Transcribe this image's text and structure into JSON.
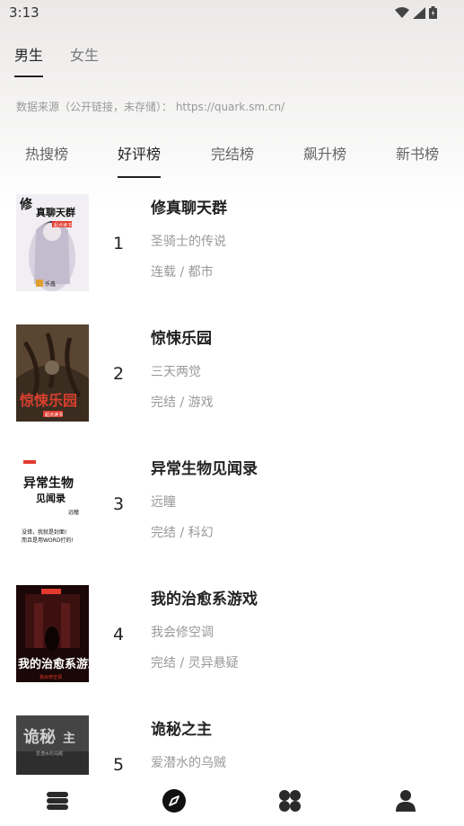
{
  "status": {
    "time": "3:13"
  },
  "gender_tabs": [
    {
      "label": "男生",
      "active": true
    },
    {
      "label": "女生",
      "active": false
    }
  ],
  "source_note": "数据来源（公开链接，未存储）：  https://quark.sm.cn/",
  "rank_tabs": [
    {
      "label": "热搜榜",
      "active": false
    },
    {
      "label": "好评榜",
      "active": true
    },
    {
      "label": "完结榜",
      "active": false
    },
    {
      "label": "飙升榜",
      "active": false
    },
    {
      "label": "新书榜",
      "active": false
    }
  ],
  "books": [
    {
      "rank": "1",
      "title": "修真聊天群",
      "author": "圣骑士的传说",
      "meta": "连载 / 都市",
      "cover_text": "修真聊天群",
      "cover_badge": "起点读书",
      "cover_colors": [
        "#f2f0f2",
        "#c9c4d6"
      ]
    },
    {
      "rank": "2",
      "title": "惊悚乐园",
      "author": "三天两觉",
      "meta": "完结 / 游戏",
      "cover_text": "惊悚乐园",
      "cover_badge": "起点读书",
      "cover_colors": [
        "#4b3a2b",
        "#2a1d14"
      ]
    },
    {
      "rank": "3",
      "title": "异常生物见闻录",
      "author": "远瞳",
      "meta": "完结 / 科幻",
      "cover_text": "异常生物见闻录",
      "cover_badge": "没错，我就是封面！而且是用WORD打的！",
      "cover_colors": [
        "#ffffff",
        "#ffffff"
      ]
    },
    {
      "rank": "4",
      "title": "我的治愈系游戏",
      "author": "我会修空调",
      "meta": "完结 / 灵异悬疑",
      "cover_text": "我的治愈系游戏",
      "cover_badge": "起点读书",
      "cover_colors": [
        "#2a0d0d",
        "#0d0404"
      ]
    },
    {
      "rank": "5",
      "title": "诡秘之主",
      "author": "爱潜水的乌贼",
      "meta": "",
      "cover_text": "诡秘之主",
      "cover_badge": "",
      "cover_colors": [
        "#3a3a3a",
        "#1c1c1c"
      ]
    }
  ],
  "bottom_nav": [
    {
      "icon": "bookshelf-icon"
    },
    {
      "icon": "compass-icon"
    },
    {
      "icon": "grid-icon"
    },
    {
      "icon": "profile-icon"
    }
  ]
}
